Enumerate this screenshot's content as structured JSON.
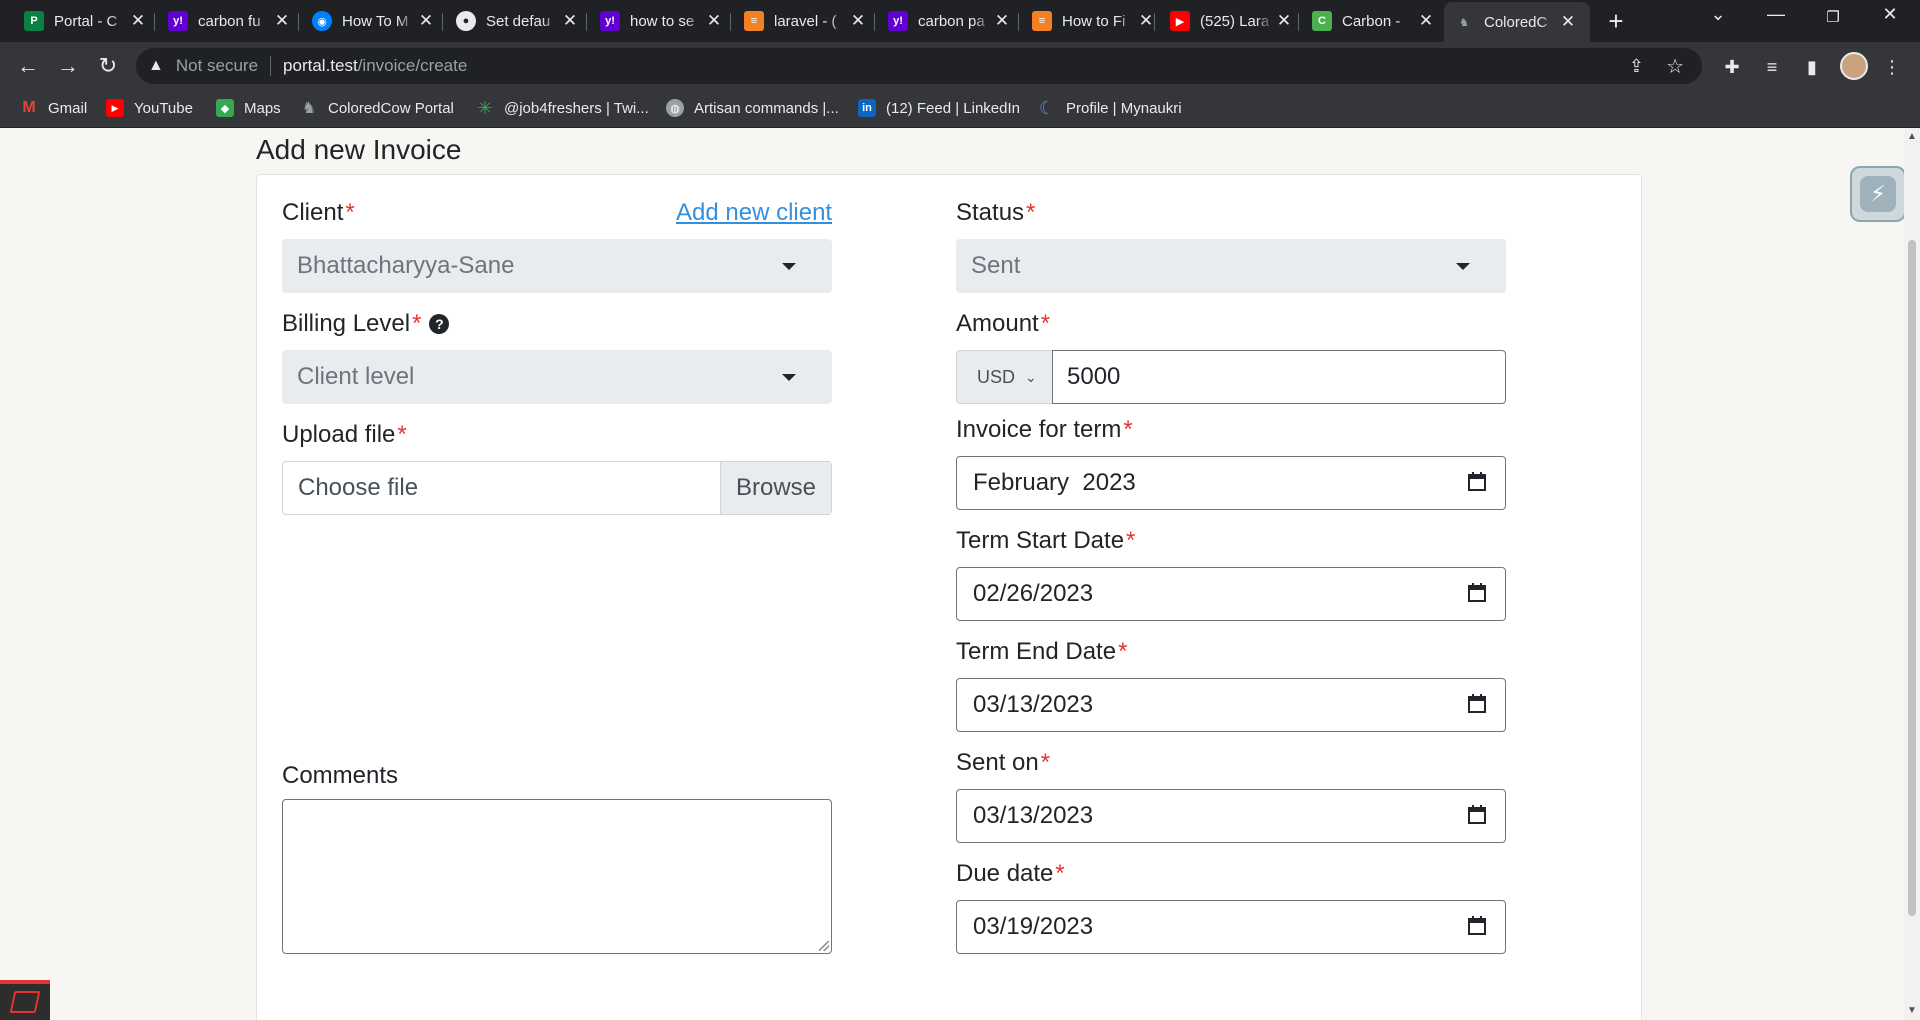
{
  "browser": {
    "tabs": [
      {
        "title": "Portal - C",
        "icon": "portal-icon",
        "color": "#0b8043"
      },
      {
        "title": "carbon fu",
        "icon": "yahoo-icon",
        "color": "#6001d2"
      },
      {
        "title": "How To M",
        "icon": "digitalocean-icon",
        "color": "#0080ff"
      },
      {
        "title": "Set defau",
        "icon": "github-icon",
        "color": "#24292e"
      },
      {
        "title": "how to se",
        "icon": "yahoo-icon",
        "color": "#6001d2"
      },
      {
        "title": "laravel - (",
        "icon": "stackoverflow-icon",
        "color": "#f48024"
      },
      {
        "title": "carbon pa",
        "icon": "yahoo-icon",
        "color": "#6001d2"
      },
      {
        "title": "How to Fi",
        "icon": "stackoverflow-icon",
        "color": "#f48024"
      },
      {
        "title": "(525) Lara",
        "icon": "youtube-icon",
        "color": "#ff0000"
      },
      {
        "title": "Carbon -",
        "icon": "carbon-icon",
        "color": "#4caf50"
      },
      {
        "title": "ColoredC",
        "icon": "coloredcow-icon",
        "color": "#9aa0a6"
      }
    ],
    "address": {
      "security_label": "Not secure",
      "host": "portal.test",
      "path": "/invoice/create"
    },
    "bookmarks": [
      {
        "label": "Gmail",
        "icon": "gmail-icon",
        "color": "#ea4335"
      },
      {
        "label": "YouTube",
        "icon": "youtube-icon",
        "color": "#ff0000"
      },
      {
        "label": "Maps",
        "icon": "maps-icon",
        "color": "#34a853"
      },
      {
        "label": "ColoredCow Portal",
        "icon": "coloredcow-icon",
        "color": "#9aa0a6"
      },
      {
        "label": "@job4freshers | Twi...",
        "icon": "twitter-icon",
        "color": "#34a853"
      },
      {
        "label": "Artisan commands |...",
        "icon": "globe-icon",
        "color": "#9aa0a6"
      },
      {
        "label": "(12) Feed | LinkedIn",
        "icon": "linkedin-icon",
        "color": "#0a66c2"
      },
      {
        "label": "Profile | Mynaukri",
        "icon": "naukri-icon",
        "color": "#4a90e2"
      }
    ]
  },
  "page": {
    "title": "Add new Invoice",
    "left": {
      "client": {
        "label": "Client",
        "required": "*",
        "add_link": "Add new client",
        "value": "Bhattacharyya-Sane"
      },
      "billing_level": {
        "label": "Billing Level",
        "required": "*",
        "help": "?",
        "value": "Client level"
      },
      "upload": {
        "label": "Upload file",
        "required": "*",
        "placeholder": "Choose file",
        "browse": "Browse"
      },
      "comments": {
        "label": "Comments",
        "value": ""
      }
    },
    "right": {
      "status": {
        "label": "Status",
        "required": "*",
        "value": "Sent"
      },
      "amount": {
        "label": "Amount",
        "required": "*",
        "currency": "USD",
        "value": "5000"
      },
      "invoice_term": {
        "label": "Invoice for term",
        "required": "*",
        "value": "February  2023"
      },
      "term_start": {
        "label": "Term Start Date",
        "required": "*",
        "value": "02/26/2023"
      },
      "term_end": {
        "label": "Term End Date",
        "required": "*",
        "value": "03/13/2023"
      },
      "sent_on": {
        "label": "Sent on",
        "required": "*",
        "value": "03/13/2023"
      },
      "due_date": {
        "label": "Due date",
        "required": "*",
        "value": "03/19/2023"
      }
    }
  },
  "colors": {
    "required": "#e3342f",
    "link": "#3490dc",
    "chrome_dark": "#202124",
    "chrome_toolbar": "#35363a"
  }
}
